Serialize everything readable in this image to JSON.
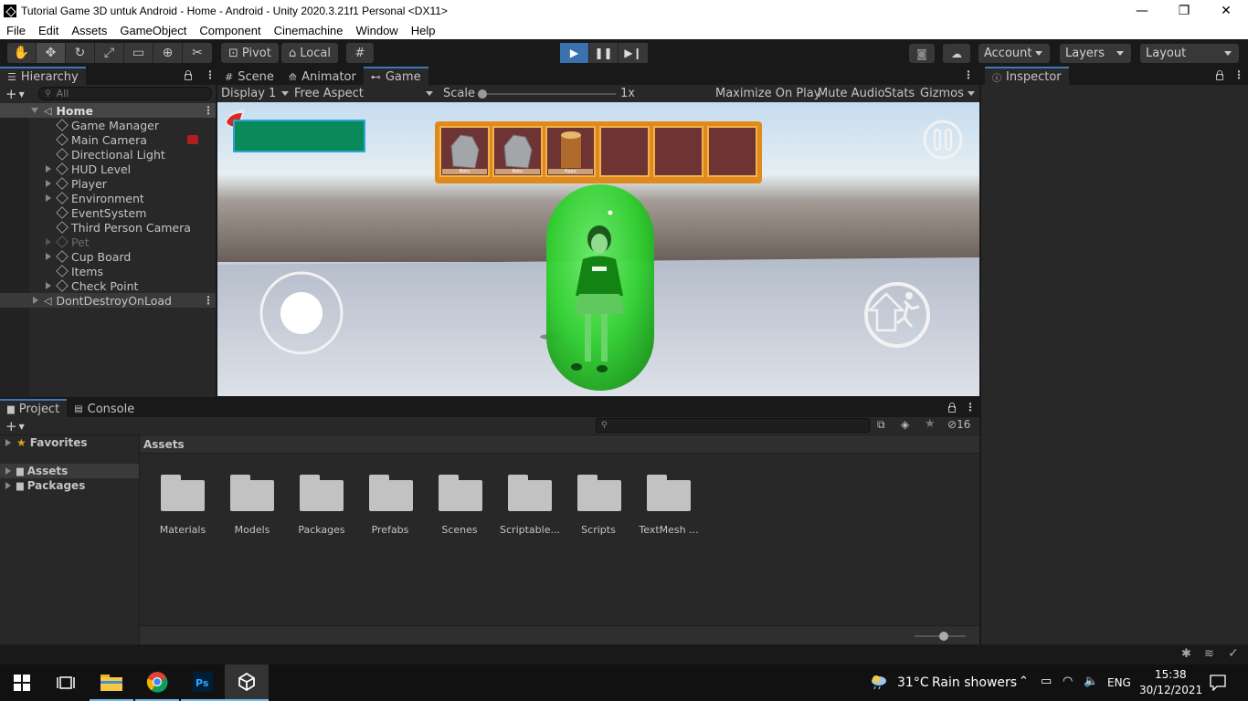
{
  "window": {
    "title": "Tutorial Game 3D untuk Android - Home - Android - Unity 2020.3.21f1 Personal <DX11>",
    "minimize": "—",
    "restore": "❐",
    "close": "✕"
  },
  "menu": [
    "File",
    "Edit",
    "Assets",
    "GameObject",
    "Component",
    "Cinemachine",
    "Window",
    "Help"
  ],
  "toolbar": {
    "pivot": "Pivot",
    "local": "Local",
    "account": "Account",
    "layers": "Layers",
    "layout": "Layout"
  },
  "hierarchy": {
    "tab": "Hierarchy",
    "search_placeholder": "All",
    "scene": "Home",
    "items": [
      {
        "label": "Game Manager"
      },
      {
        "label": "Main Camera"
      },
      {
        "label": "Directional Light"
      },
      {
        "label": "HUD Level"
      },
      {
        "label": "Player"
      },
      {
        "label": "Environment"
      },
      {
        "label": "EventSystem"
      },
      {
        "label": "Third Person Camera"
      },
      {
        "label": "Pet"
      },
      {
        "label": "Cup Board"
      },
      {
        "label": "Items"
      },
      {
        "label": "Check Point"
      }
    ],
    "dontdestroy": "DontDestroyOnLoad"
  },
  "center_tabs": {
    "scene": "Scene",
    "animator": "Animator",
    "game": "Game"
  },
  "game_bar": {
    "display": "Display 1",
    "aspect": "Free Aspect",
    "scale_label": "Scale",
    "scale_value": "1x",
    "maximize": "Maximize On Play",
    "mute": "Mute Audio",
    "stats": "Stats",
    "gizmos": "Gizmos"
  },
  "game_hud": {
    "inventory_slots": [
      {
        "item": "Rock",
        "caption": "Batu"
      },
      {
        "item": "Rock",
        "caption": "Batu"
      },
      {
        "item": "Wood",
        "caption": "Kayu"
      },
      {
        "item": "",
        "caption": ""
      },
      {
        "item": "",
        "caption": ""
      },
      {
        "item": "",
        "caption": ""
      }
    ]
  },
  "inspector": {
    "tab": "Inspector"
  },
  "project": {
    "tab_project": "Project",
    "tab_console": "Console",
    "hidden_count": "16",
    "favorites": "Favorites",
    "tree": [
      "Assets",
      "Packages"
    ],
    "breadcrumb": "Assets",
    "folders": [
      "Materials",
      "Models",
      "Packages",
      "Prefabs",
      "Scenes",
      "Scriptable...",
      "Scripts",
      "TextMesh ..."
    ]
  },
  "taskbar": {
    "weather_temp": "31°C",
    "weather_text": "Rain showers",
    "language": "ENG",
    "time": "15:38",
    "date": "30/12/2021"
  },
  "colors": {
    "play_active": "#3a72b0",
    "tab_accent": "#3a79bb",
    "hud_green": "#0a8a5a",
    "inventory_border": "#e08a1e",
    "inventory_slot": "#6e3434",
    "capsule": "#2fd02f"
  }
}
